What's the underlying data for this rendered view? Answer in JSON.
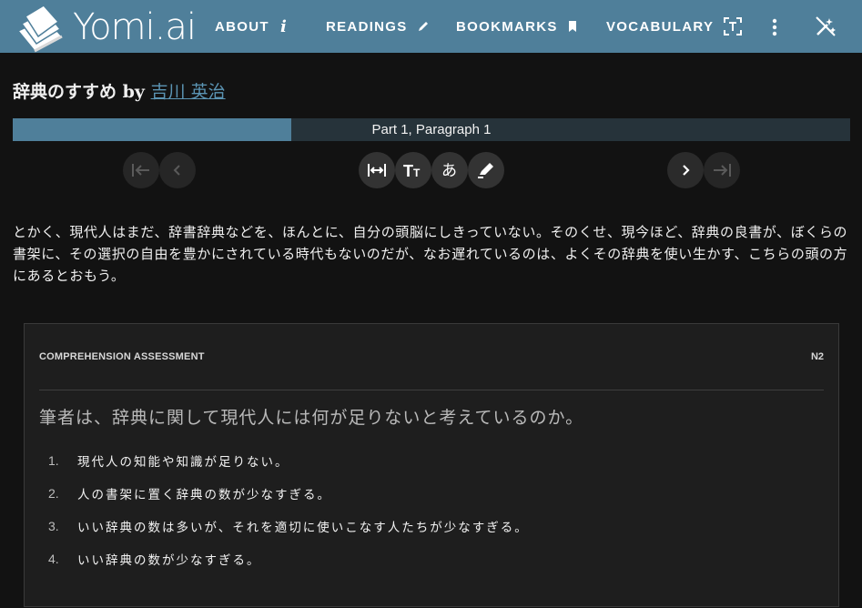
{
  "header": {
    "brand": "Yomi.ai",
    "nav": {
      "about": "ABOUT",
      "readings": "READINGS",
      "bookmarks": "BOOKMARKS",
      "vocabulary": "VOCABULARY"
    },
    "icons": {
      "logo": "book-stack-icon",
      "about": "info-icon",
      "readings": "pencil-icon",
      "bookmarks": "bookmark-icon",
      "vocabulary": "text-frame-icon",
      "more": "more-vertical-icon",
      "magic": "magic-wand-off-icon"
    },
    "colors": {
      "bar": "#4f7f9a",
      "text": "#ffffff"
    }
  },
  "reading": {
    "title": "辞典のすすめ",
    "by": " by ",
    "author": "吉川 英治",
    "progress_label": "Part 1, Paragraph 1",
    "progress_fraction": 0.333,
    "paragraph": "とかく、現代人はまだ、辞書辞典などを、ほんとに、自分の頭脳にしきっていない。そのくせ、現今ほど、辞典の良書が、ぼくらの書架に、その選択の自由を豊かにされている時代もないのだが、なお遅れているのは、よくその辞典を使い生かす、こちらの頭の方にあるとおもう。"
  },
  "controls": {
    "icons": [
      "first-page-icon",
      "chevron-left-icon",
      "width-toggle-icon",
      "font-size-icon",
      "furigana-icon",
      "highlighter-icon",
      "chevron-right-icon",
      "last-page-icon"
    ]
  },
  "assessment": {
    "label": "COMPREHENSION ASSESSMENT",
    "level": "N2",
    "question": "筆者は、辞典に関して現代人には何が足りないと考えているのか。",
    "choices": [
      {
        "num": "1.",
        "text": "現代人の知能や知識が足りない。"
      },
      {
        "num": "2.",
        "text": "人の書架に置く辞典の数が少なすぎる。"
      },
      {
        "num": "3.",
        "text": "いい辞典の数は多いが、それを適切に使いこなす人たちが少なすぎる。"
      },
      {
        "num": "4.",
        "text": "いい辞典の数が少なすぎる。"
      }
    ]
  },
  "colors": {
    "background": "#121212",
    "accent": "#4f7f9a",
    "link": "#5b94b3",
    "progress_track": "#26333a",
    "card": "#1e1e1e"
  }
}
